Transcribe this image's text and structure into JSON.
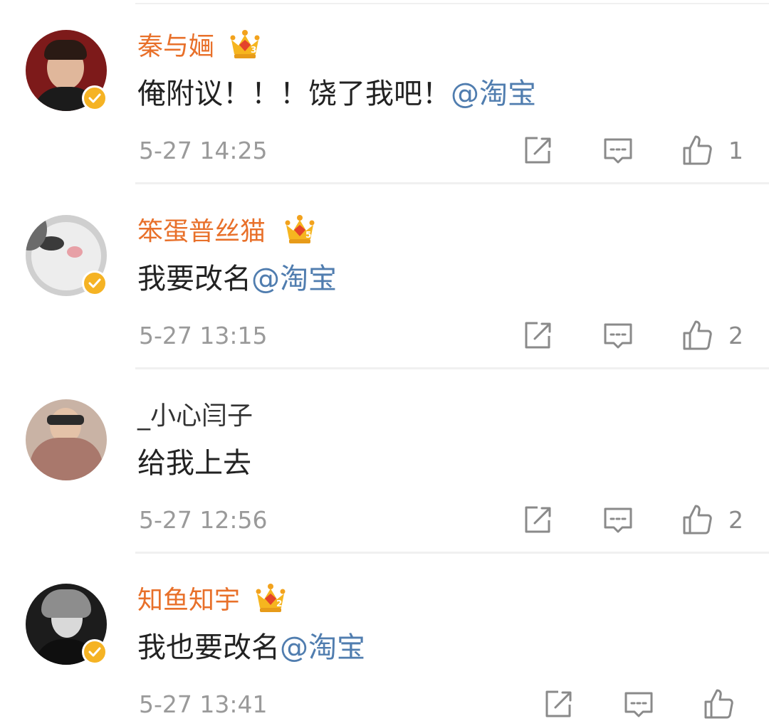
{
  "comments": [
    {
      "username": "秦与婳",
      "vip_level": "3",
      "text": "俺附议！！！饶了我吧！",
      "mention": "@淘宝",
      "time": "5-27 14:25",
      "likes": "1",
      "verified": true
    },
    {
      "username": "笨蛋普丝猫",
      "vip_level": "5",
      "text": "我要改名",
      "mention": "@淘宝",
      "time": "5-27 13:15",
      "likes": "2",
      "verified": true
    },
    {
      "username": "_小心闫子",
      "vip_level": "",
      "text": "给我上去",
      "mention": "",
      "time": "5-27 12:56",
      "likes": "2",
      "verified": false
    },
    {
      "username": "知鱼知宇",
      "vip_level": "2",
      "text": "我也要改名",
      "mention": "@淘宝",
      "time": "5-27 13:41",
      "likes": "",
      "verified": true
    }
  ],
  "colors": {
    "username_vip": "#e8702a",
    "mention": "#507daf",
    "meta": "#9a9a9a",
    "verify_badge": "#f5b324"
  },
  "icons": {
    "verify": "verified-badge-icon",
    "vip": "vip-crown-icon",
    "repost": "repost-icon",
    "comment": "comment-icon",
    "like": "thumbs-up-icon"
  }
}
